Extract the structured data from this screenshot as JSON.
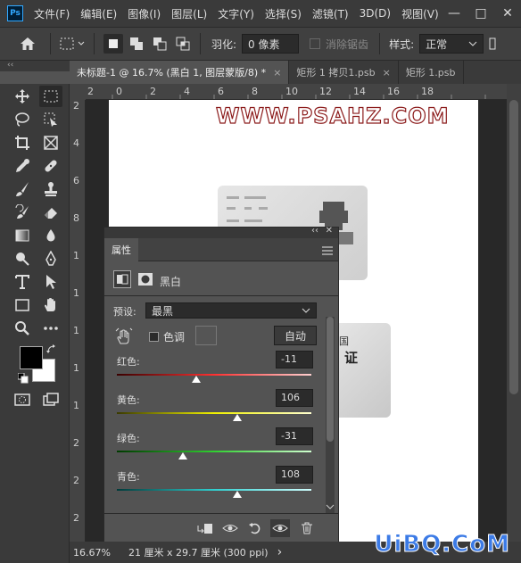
{
  "app": {
    "logo": "Ps"
  },
  "menu": [
    "文件(F)",
    "编辑(E)",
    "图像(I)",
    "图层(L)",
    "文字(Y)",
    "选择(S)",
    "滤镜(T)",
    "3D(D)",
    "视图(V)"
  ],
  "window_controls": {
    "minimize": "—",
    "maximize": "□",
    "close": "✕"
  },
  "options": {
    "feather_label": "羽化:",
    "feather_value": "0 像素",
    "antialias_label": "消除锯齿",
    "style_label": "样式:",
    "style_value": "正常"
  },
  "tabs": [
    {
      "title": "未标题-1 @ 16.7% (黑白 1, 图层蒙版/8) *",
      "close": "×"
    },
    {
      "title": "矩形 1 拷贝1.psb",
      "close": "×"
    },
    {
      "title": "矩形 1.psb"
    }
  ],
  "panel_collapse": "‹‹",
  "ruler_h": [
    "2",
    "0",
    "2",
    "4",
    "6",
    "8",
    "10",
    "12",
    "14",
    "16",
    "18"
  ],
  "ruler_v": [
    "2",
    "4",
    "6",
    "8",
    "1",
    "1",
    "1",
    "1",
    "1",
    "2",
    "2",
    "2"
  ],
  "canvas": {
    "watermark": "WWW.PSAHZ.COM",
    "card_text": "国",
    "card_text2": "证"
  },
  "properties": {
    "title": "属性",
    "collapse": "‹‹",
    "close": "✕",
    "adjustment_name": "黑白",
    "preset_label": "预设:",
    "preset_value": "最黑",
    "tint_label": "色调",
    "auto_label": "自动",
    "sliders": [
      {
        "label": "红色:",
        "value": "-11",
        "fraction": 0.41,
        "colors": [
          "#3a0000",
          "#ff3030",
          "#ffd0d0"
        ]
      },
      {
        "label": "黄色:",
        "value": "106",
        "fraction": 0.62,
        "colors": [
          "#3a3a00",
          "#f0f000",
          "#ffffd0"
        ]
      },
      {
        "label": "绿色:",
        "value": "-31",
        "fraction": 0.34,
        "colors": [
          "#003a00",
          "#30d030",
          "#d0ffd0"
        ]
      },
      {
        "label": "青色:",
        "value": "108",
        "fraction": 0.62,
        "colors": [
          "#003a3a",
          "#30d0d0",
          "#d0ffff"
        ]
      }
    ]
  },
  "status": {
    "zoom": "16.67%",
    "doc_info": "21 厘米 x 29.7 厘米 (300 ppi)",
    "arrow": "›"
  },
  "brand_watermark": "UiBQ.CoM"
}
